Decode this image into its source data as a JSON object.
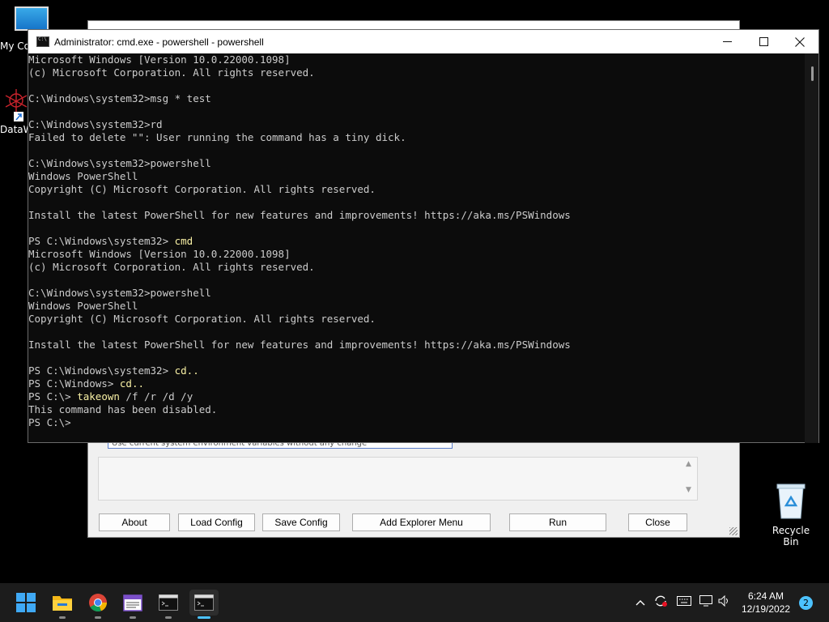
{
  "desktop": {
    "icons": [
      {
        "label": "My Co"
      },
      {
        "label": "DataW"
      },
      {
        "label": "Recycle Bin"
      }
    ]
  },
  "background_window": {
    "path_text": "Use current system environment variables without any change",
    "buttons": [
      "About",
      "Load Config",
      "Save Config",
      "Add Explorer Menu",
      "Run",
      "Close"
    ]
  },
  "console": {
    "title": "Administrator: cmd.exe - powershell - powershell",
    "lines": [
      "Microsoft Windows [Version 10.0.22000.1098]",
      "(c) Microsoft Corporation. All rights reserved.",
      "",
      "C:\\Windows\\system32>msg * test",
      "",
      "C:\\Windows\\system32>rd",
      "Failed to delete \"\": User running the command has a tiny dick.",
      "",
      "C:\\Windows\\system32>powershell",
      "Windows PowerShell",
      "Copyright (C) Microsoft Corporation. All rights reserved.",
      "",
      "Install the latest PowerShell for new features and improvements! https://aka.ms/PSWindows",
      "",
      "PS C:\\Windows\\system32> cmd",
      "Microsoft Windows [Version 10.0.22000.1098]",
      "(c) Microsoft Corporation. All rights reserved.",
      "",
      "C:\\Windows\\system32>powershell",
      "Windows PowerShell",
      "Copyright (C) Microsoft Corporation. All rights reserved.",
      "",
      "Install the latest PowerShell for new features and improvements! https://aka.ms/PSWindows",
      "",
      "PS C:\\Windows\\system32> cd..",
      "PS C:\\Windows> cd..",
      "PS C:\\> takeown /f /r /d /y",
      "This command has been disabled.",
      "PS C:\\>"
    ]
  },
  "taskbar": {
    "items": [
      "start-icon",
      "file-explorer-icon",
      "chrome-icon",
      "file-manager-icon",
      "terminal-icon",
      "terminal-active-icon"
    ],
    "clock": {
      "time": "6:24 AM",
      "date": "12/19/2022"
    },
    "notification_count": "2"
  },
  "colors": {
    "console_bg": "#0c0c0c",
    "console_text": "#cccccc",
    "ps_command": "#f9f1a5",
    "ps_param": "#cccccc",
    "taskbar_bg": "#1c1c1c",
    "accent": "#4cc2ff"
  }
}
